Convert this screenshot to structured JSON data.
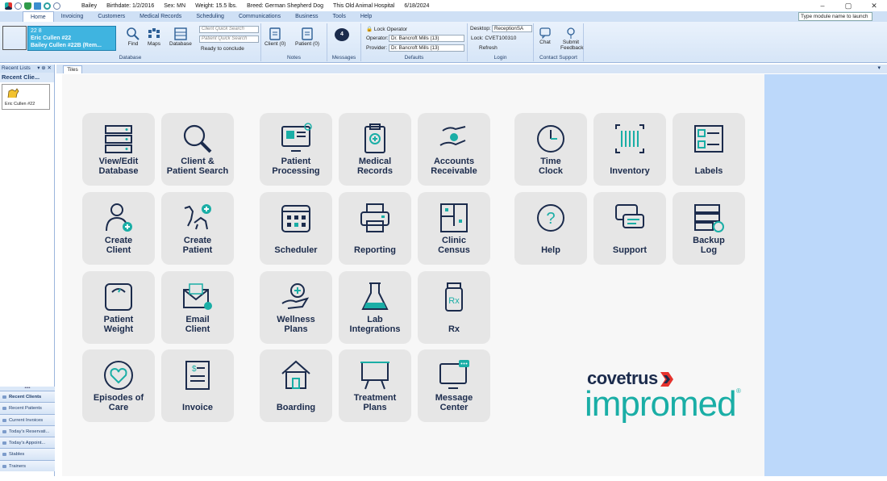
{
  "titlebar": {
    "patient_name": "Bailey",
    "birthdate": "Birthdate:  1/2/2016",
    "sex": "Sex:  MN",
    "weight": "Weight:  15.5 lbs.",
    "breed": "Breed:  German Shepherd Dog",
    "hospital": "This Old Animal Hospital",
    "date": "6/18/2024"
  },
  "menu": {
    "tabs": [
      "Home",
      "Invoicing",
      "Customers",
      "Medical Records",
      "Scheduling",
      "Communications",
      "Business",
      "Tools",
      "Help"
    ],
    "module_launch_placeholder": "Type module name to launch"
  },
  "ribbon": {
    "patient_card": {
      "line1": "22     8",
      "client": "Eric Cullen #22",
      "patient": "Bailey Cullen #22B (Rem..."
    },
    "find_label": "Find",
    "maps_label": "Maps",
    "database_label": "Database",
    "client_search_placeholder": "Client Quick Search",
    "patient_search_placeholder": "Patient Quick Search",
    "ready_to_conclude": "Ready to conclude",
    "group_database": "Database",
    "client_notes": "Client (0)",
    "patient_notes": "Patient (0)",
    "group_notes": "Notes",
    "messages_count": "4",
    "group_messages": "Messages",
    "lock_operator": "Lock Operator",
    "operator_label": "Operator:",
    "operator_value": "Dr. Bancroft Mills (13)",
    "provider_label": "Provider:",
    "provider_value": "Dr. Bancroft Mills (13)",
    "group_defaults": "Defaults",
    "desktop_label": "Desktop:",
    "desktop_value": "ReceptionSA",
    "lock_value": "Lock: CVET100310",
    "refresh": "Refresh",
    "group_login": "Login",
    "chat": "Chat",
    "submit_feedback": "Submit Feedback",
    "group_contact": "Contact Support"
  },
  "left_panel": {
    "header": "Recent Lists",
    "subheader": "Recent Clie...",
    "recent_card_name": "Eric Cullen #22",
    "nav": [
      "Recent Clients",
      "Recent Patients",
      "Current Invoices",
      "Today's Reservati...",
      "Today's Appoint...",
      "Stables",
      "Trainers"
    ]
  },
  "tab_label": "Tiles",
  "tiles": [
    {
      "label": "View/Edit Database",
      "icon": "database-server-icon"
    },
    {
      "label": "Client & Patient Search",
      "icon": "magnifier-icon"
    },
    {
      "label": "Patient Processing",
      "icon": "monitor-icon"
    },
    {
      "label": "Medical Records",
      "icon": "clipboard-icon"
    },
    {
      "label": "Accounts Receivable",
      "icon": "hand-money-icon"
    },
    {
      "label": "Time Clock",
      "icon": "clock-icon"
    },
    {
      "label": "Inventory",
      "icon": "barcode-icon"
    },
    {
      "label": "Labels",
      "icon": "labels-icon"
    },
    {
      "label": "Create Client",
      "icon": "person-add-icon"
    },
    {
      "label": "Create Patient",
      "icon": "pets-add-icon"
    },
    {
      "label": "Scheduler",
      "icon": "calendar-icon"
    },
    {
      "label": "Reporting",
      "icon": "printer-icon"
    },
    {
      "label": "Clinic Census",
      "icon": "floorplan-icon"
    },
    {
      "label": "Help",
      "icon": "question-icon"
    },
    {
      "label": "Support",
      "icon": "chat-bubbles-icon"
    },
    {
      "label": "Backup Log",
      "icon": "backup-icon"
    },
    {
      "label": "Patient Weight",
      "icon": "scale-icon"
    },
    {
      "label": "Email Client",
      "icon": "envelope-icon"
    },
    {
      "label": "Wellness Plans",
      "icon": "hand-plus-icon"
    },
    {
      "label": "Lab Integrations",
      "icon": "flask-icon"
    },
    {
      "label": "Rx",
      "icon": "pill-bottle-icon"
    },
    {
      "label": "Episodes of Care",
      "icon": "heart-icon"
    },
    {
      "label": "Invoice",
      "icon": "invoice-icon"
    },
    {
      "label": "Boarding",
      "icon": "house-icon"
    },
    {
      "label": "Treatment Plans",
      "icon": "easel-icon"
    },
    {
      "label": "Message Center",
      "icon": "monitor-message-icon"
    }
  ],
  "brand": {
    "top": "covetrus",
    "bottom": "impromed",
    "registered": "®"
  },
  "colors": {
    "tile_bg": "#e6e6e6",
    "icon_navy": "#1b2b4c",
    "icon_teal": "#1aaea6",
    "canvas_bg": "#f7f7f7",
    "right_strip": "#bcd8fa",
    "ribbon": "#d6e5f7"
  }
}
